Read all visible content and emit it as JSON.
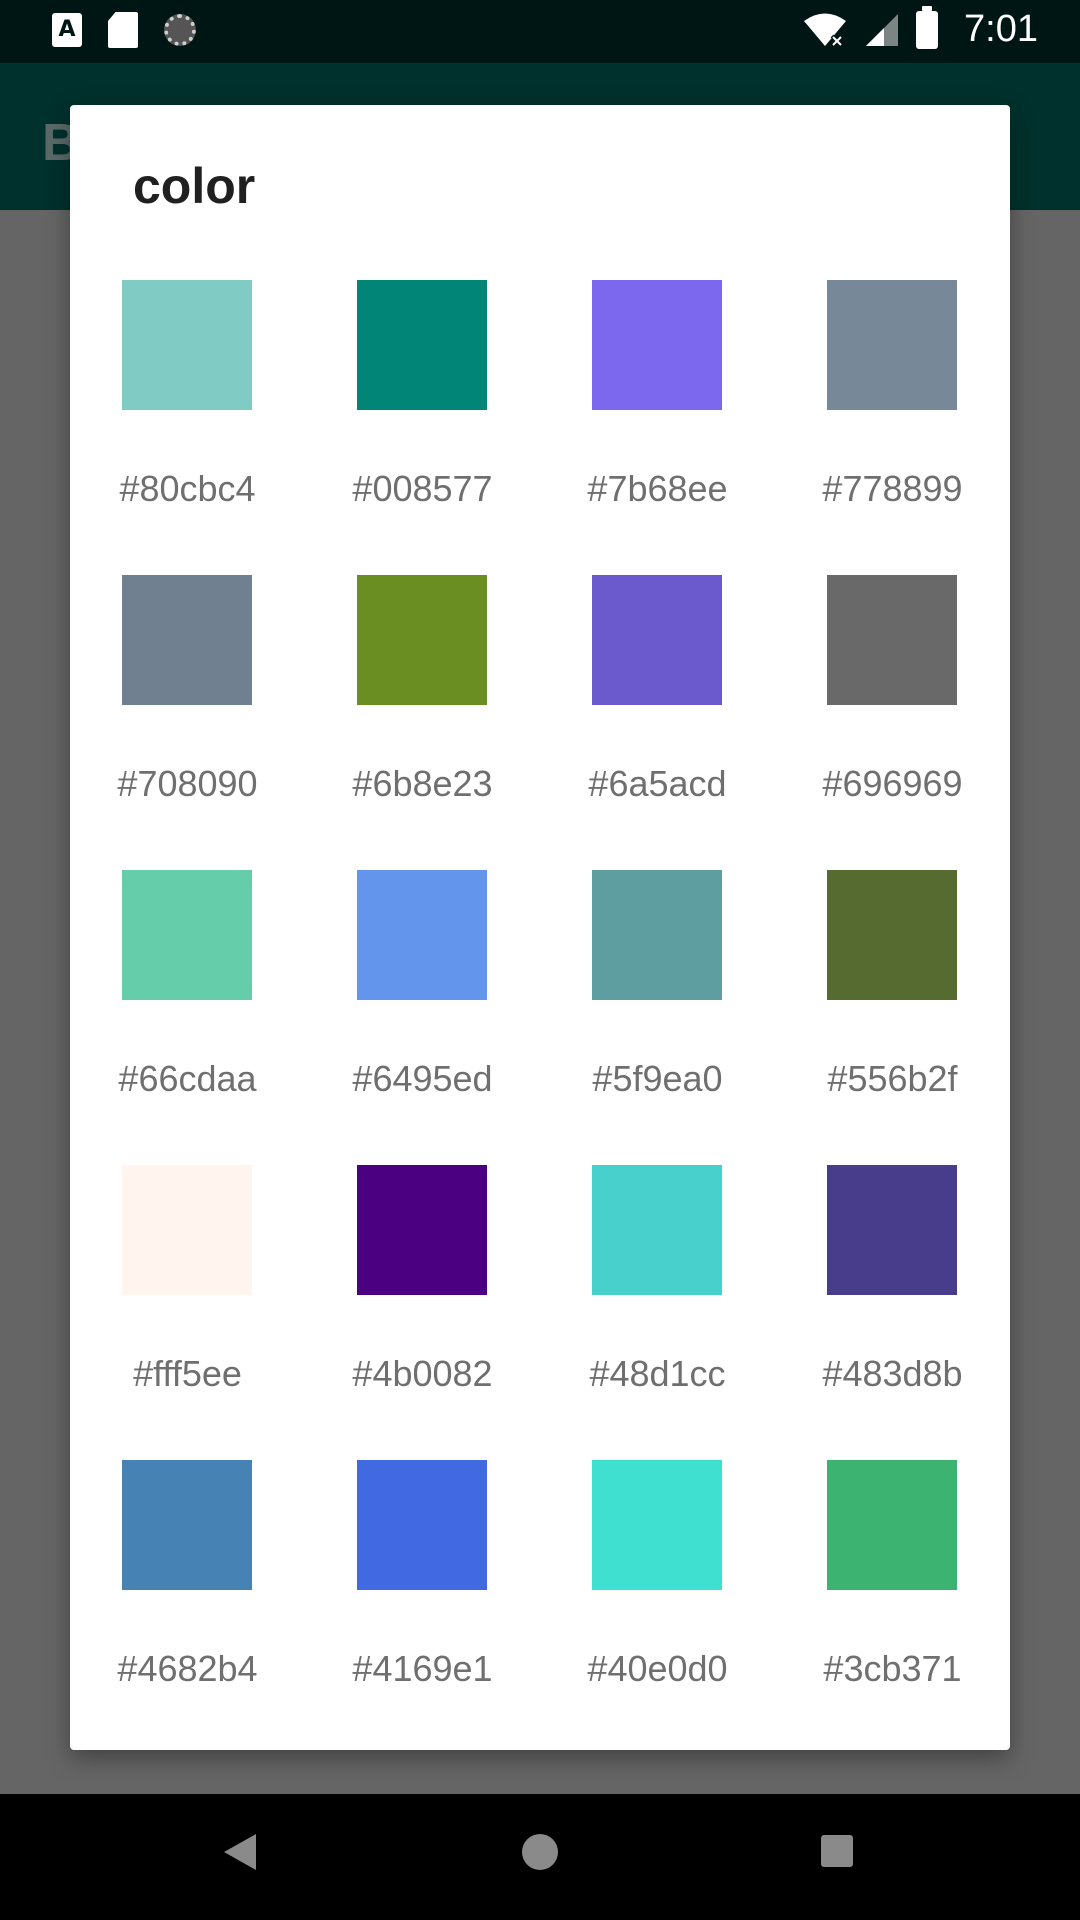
{
  "status_bar": {
    "time": "7:01",
    "icons": [
      "app-a-icon",
      "sd-card-icon",
      "loading-icon",
      "wifi-icon",
      "signal-icon",
      "battery-icon"
    ]
  },
  "app_bar": {
    "title": "B"
  },
  "dialog": {
    "title": "color",
    "colors": [
      {
        "hex": "#80cbc4"
      },
      {
        "hex": "#008577"
      },
      {
        "hex": "#7b68ee"
      },
      {
        "hex": "#778899"
      },
      {
        "hex": "#708090"
      },
      {
        "hex": "#6b8e23"
      },
      {
        "hex": "#6a5acd"
      },
      {
        "hex": "#696969"
      },
      {
        "hex": "#66cdaa"
      },
      {
        "hex": "#6495ed"
      },
      {
        "hex": "#5f9ea0"
      },
      {
        "hex": "#556b2f"
      },
      {
        "hex": "#fff5ee"
      },
      {
        "hex": "#4b0082"
      },
      {
        "hex": "#48d1cc"
      },
      {
        "hex": "#483d8b"
      },
      {
        "hex": "#4682b4"
      },
      {
        "hex": "#4169e1"
      },
      {
        "hex": "#40e0d0"
      },
      {
        "hex": "#3cb371"
      }
    ]
  },
  "nav_bar": {
    "icons": [
      "back-icon",
      "home-icon",
      "recents-icon"
    ]
  }
}
